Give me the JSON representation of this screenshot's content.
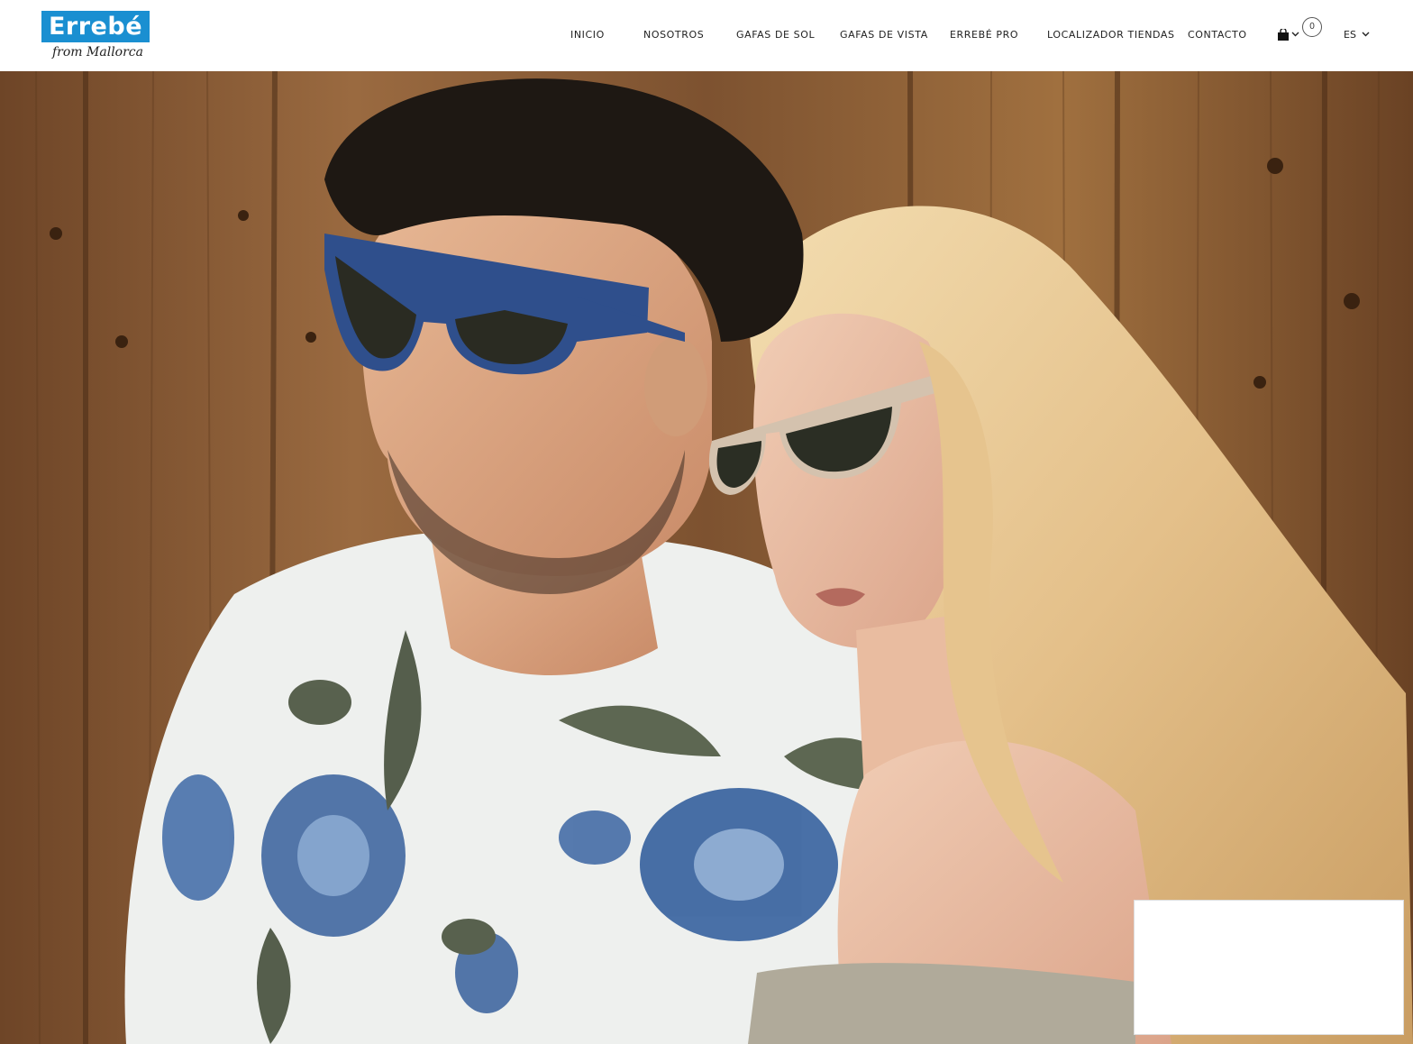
{
  "brand": {
    "name": "Errebé",
    "tagline": "from Mallorca",
    "color": "#1a8fd1"
  },
  "nav": {
    "items": [
      {
        "label": "INICIO"
      },
      {
        "label": "NOSOTROS"
      },
      {
        "label": "GAFAS DE SOL"
      },
      {
        "label": "GAFAS DE VISTA"
      },
      {
        "label": "ERREBÉ PRO"
      },
      {
        "label": "LOCALIZADOR TIENDAS"
      },
      {
        "label": "CONTACTO"
      }
    ]
  },
  "cart": {
    "icon": "shopping-bag-icon",
    "count": "0"
  },
  "language": {
    "current": "ES",
    "icon": "chevron-down-icon"
  },
  "hero": {
    "description_icon": "hero-photo"
  }
}
